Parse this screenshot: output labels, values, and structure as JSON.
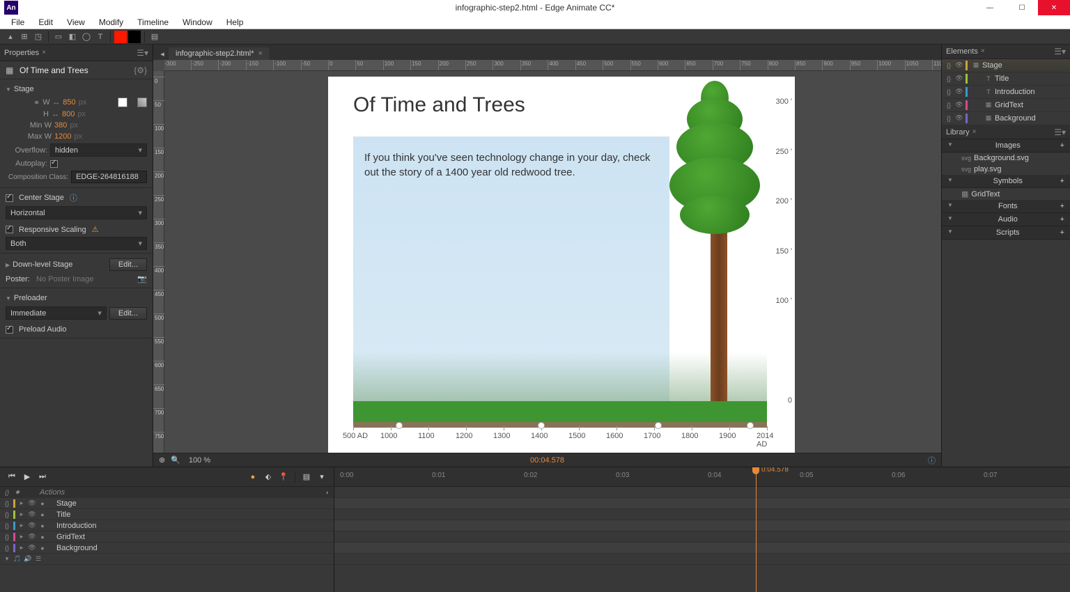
{
  "window": {
    "title": "infographic-step2.html - Edge Animate CC*",
    "icon": "An"
  },
  "menus": [
    "File",
    "Edit",
    "View",
    "Modify",
    "Timeline",
    "Window",
    "Help"
  ],
  "document_tab": "infographic-step2.html*",
  "properties": {
    "title": "Properties",
    "object": "Of Time and Trees",
    "stage_label": "Stage",
    "w_label": "W",
    "w_val": "850",
    "w_unit": "px",
    "h_label": "H",
    "h_val": "800",
    "h_unit": "px",
    "minw_label": "Min W",
    "minw_val": "380",
    "minw_unit": "px",
    "maxw_label": "Max W",
    "maxw_val": "1200",
    "maxw_unit": "px",
    "overflow_label": "Overflow:",
    "overflow_val": "hidden",
    "autoplay_label": "Autoplay:",
    "compclass_label": "Composition Class:",
    "compclass_val": "EDGE-264816188",
    "center_label": "Center Stage",
    "center_sel": "Horizontal",
    "responsive_label": "Responsive Scaling",
    "responsive_sel": "Both",
    "downlevel_label": "Down-level Stage",
    "edit_btn": "Edit...",
    "poster_label": "Poster:",
    "poster_val": "No Poster Image",
    "preloader_label": "Preloader",
    "preloader_sel": "Immediate",
    "preload_audio": "Preload Audio"
  },
  "stage": {
    "title": "Of Time and Trees",
    "intro": "If you think you've seen technology change in your day, check out the story of a 1400 year old redwood tree.",
    "yaxis": [
      "300 '",
      "250 '",
      "200 '",
      "150 '",
      "100 '",
      "0"
    ],
    "xaxis": [
      "500 AD",
      "1000",
      "1100",
      "1200",
      "1300",
      "1400",
      "1500",
      "1600",
      "1700",
      "1800",
      "1900",
      "2014 AD"
    ]
  },
  "status": {
    "zoom": "100 %",
    "time": "00:04.578"
  },
  "elements": {
    "title": "Elements",
    "rows": [
      {
        "name": "Stage",
        "tag": "<div>",
        "color": "#caa339",
        "icon": "▦"
      },
      {
        "name": "Title",
        "tag": "<div>",
        "color": "#9fc339",
        "icon": "T"
      },
      {
        "name": "Introduction",
        "tag": "<div>",
        "color": "#3d97d0",
        "icon": "T"
      },
      {
        "name": "GridText",
        "tag": "",
        "color": "#d44b8e",
        "icon": "▦"
      },
      {
        "name": "Background",
        "tag": "<div>",
        "color": "#7e63c4",
        "icon": "▦"
      }
    ]
  },
  "library": {
    "title": "Library",
    "images": {
      "label": "Images",
      "items": [
        "Background.svg",
        "play.svg"
      ]
    },
    "symbols": {
      "label": "Symbols",
      "items": [
        "GridText"
      ]
    },
    "fonts": "Fonts",
    "audio": "Audio",
    "scripts": "Scripts"
  },
  "timeline": {
    "marks": [
      "0:00",
      "0:01",
      "0:02",
      "0:03",
      "0:04",
      "0:05",
      "0:06",
      "0:07"
    ],
    "playhead": "0:04.578",
    "actions": "Actions",
    "layers": [
      {
        "name": "Stage",
        "color": "#caa339"
      },
      {
        "name": "Title",
        "color": "#9fc339"
      },
      {
        "name": "Introduction",
        "color": "#3d97d0"
      },
      {
        "name": "GridText",
        "color": "#d44b8e"
      },
      {
        "name": "Background",
        "color": "#7e63c4"
      }
    ]
  }
}
